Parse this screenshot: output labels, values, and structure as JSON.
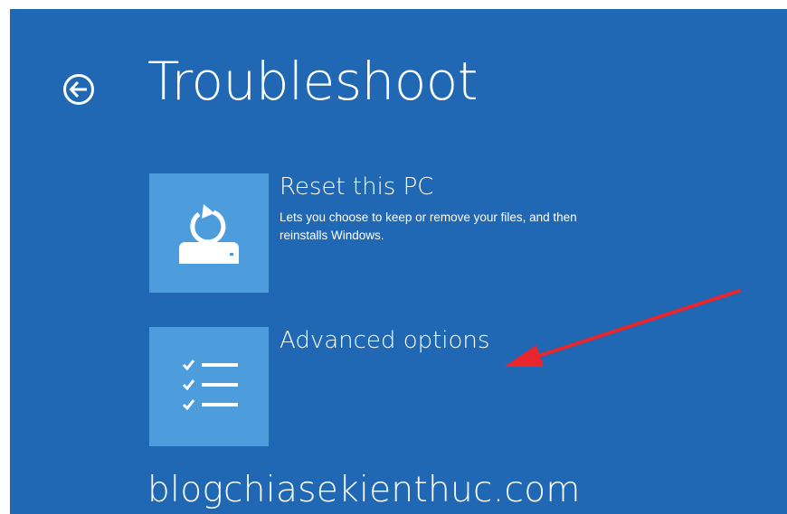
{
  "screen": {
    "title": "Troubleshoot",
    "back_icon": "back-arrow-circle-icon",
    "background_color": "#2068b3",
    "tile_color": "#4d9ddd"
  },
  "options": [
    {
      "title": "Reset this PC",
      "description": "Lets you choose to keep or remove your files, and then reinstalls Windows.",
      "icon": "reset-pc-icon"
    },
    {
      "title": "Advanced options",
      "description": "",
      "icon": "checklist-icon"
    }
  ],
  "annotation": {
    "icon": "red-arrow-icon",
    "color": "#e8262b"
  },
  "watermark": {
    "text": "blogchiasekienthuc.com"
  }
}
